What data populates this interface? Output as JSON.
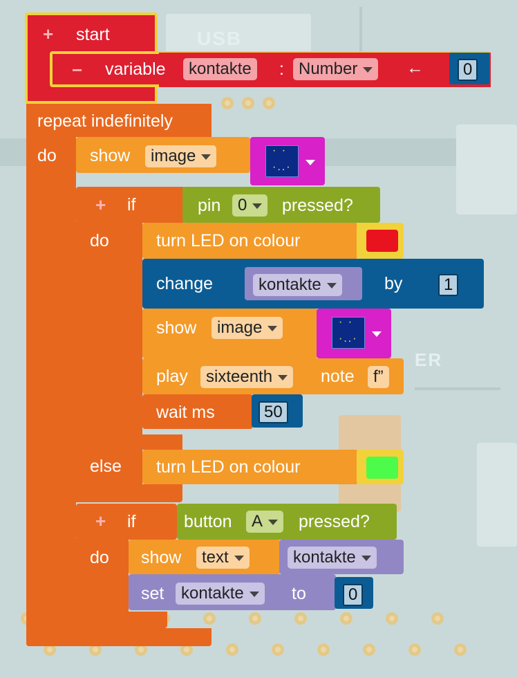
{
  "background": {
    "board_label": "USB",
    "board_label_2": "ER"
  },
  "start": {
    "plus": "+",
    "label": "start",
    "minus": "−",
    "variable_label": "variable",
    "variable_name": "kontakte",
    "colon": ":",
    "type": "Number",
    "arrow": "←",
    "init_value": "0"
  },
  "repeat": {
    "label": "repeat indefinitely",
    "do": "do"
  },
  "show_image_1": {
    "label": "show",
    "field": "image"
  },
  "if_pin": {
    "plus": "+",
    "if": "if",
    "do": "do",
    "else": "else",
    "cond_pre": "pin",
    "pin": "0",
    "cond_post": "pressed?"
  },
  "led_red": {
    "label": "turn LED on  colour",
    "color": "#e8131e"
  },
  "change": {
    "label": "change",
    "var": "kontakte",
    "by": "by",
    "value": "1"
  },
  "show_image_2": {
    "label": "show",
    "field": "image"
  },
  "play": {
    "label": "play",
    "duration": "sixteenth",
    "note_label": "note",
    "note": "f”"
  },
  "wait": {
    "label": "wait ms",
    "value": "50"
  },
  "led_green": {
    "label": "turn LED on  colour",
    "color": "#4dfb4a"
  },
  "if_button": {
    "plus": "+",
    "if": "if",
    "do": "do",
    "cond_pre": "button",
    "button": "A",
    "cond_post": "pressed?"
  },
  "show_text": {
    "label": "show",
    "field": "text",
    "var": "kontakte"
  },
  "set": {
    "label": "set",
    "var": "kontakte",
    "to": "to",
    "value": "0"
  }
}
